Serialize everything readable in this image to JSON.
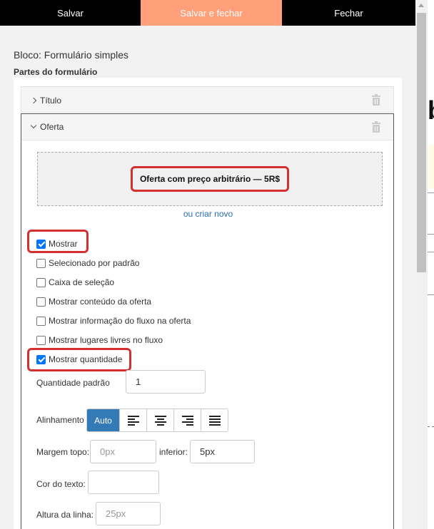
{
  "toolbar": {
    "save_label": "Salvar",
    "save_close_label": "Salvar e fechar",
    "close_label": "Fechar",
    "save_close_bg": "#ffa07a"
  },
  "panel": {
    "block_title": "Bloco: Formulário simples",
    "parts_title": "Partes do formulário"
  },
  "parts": {
    "title_item": {
      "label": "Título",
      "icon": "chevron-right-icon"
    },
    "offer_item": {
      "label": "Oferta",
      "icon": "chevron-down-icon",
      "offer_name": "Oferta com preço arbitrário — 5R$",
      "create_link": "ou criar novo"
    }
  },
  "options": [
    {
      "label": "Mostrar",
      "checked": true,
      "highlighted": true
    },
    {
      "label": "Selecionado por padrão",
      "checked": false
    },
    {
      "label": "Caixa de seleção",
      "checked": false
    },
    {
      "label": "Mostrar conteúdo da oferta",
      "checked": false
    },
    {
      "label": "Mostrar informação do fluxo na oferta",
      "checked": false
    },
    {
      "label": "Mostrar lugares livres no fluxo",
      "checked": false
    },
    {
      "label": "Mostrar quantidade",
      "checked": true,
      "highlighted": true
    }
  ],
  "fields": {
    "default_qty_label": "Quantidade padrão",
    "default_qty_value": "1",
    "alignment_label": "Alinhamento",
    "alignment_auto": "Auto",
    "alignment_options": [
      "align-left-icon",
      "align-center-icon",
      "align-right-icon",
      "align-justify-icon"
    ],
    "margin_top_label": "Margem topo:",
    "margin_top_placeholder": "0px",
    "margin_bottom_label": "inferior:",
    "margin_bottom_value": "5px",
    "text_color_label": "Cor do texto:",
    "line_height_label": "Altura da linha:",
    "line_height_placeholder": "25px"
  },
  "colors": {
    "highlight": "#d43030",
    "checkbox": "#0075ff",
    "active_button": "#337ab7",
    "link": "#2b6cb0"
  }
}
